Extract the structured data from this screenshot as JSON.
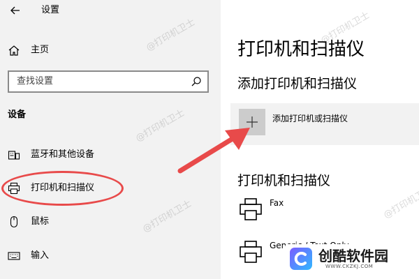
{
  "window": {
    "title": "设置"
  },
  "sidebar": {
    "home_label": "主页",
    "search": {
      "placeholder": "查找设置"
    },
    "section_heading": "设备",
    "items": [
      {
        "label": "蓝牙和其他设备",
        "icon": "keyboard-devices-icon"
      },
      {
        "label": "打印机和扫描仪",
        "icon": "printer-icon",
        "highlighted": true
      },
      {
        "label": "鼠标",
        "icon": "mouse-icon"
      },
      {
        "label": "输入",
        "icon": "keyboard-icon"
      }
    ]
  },
  "main": {
    "page_title": "打印机和扫描仪",
    "add_section_title": "添加打印机和扫描仪",
    "add_button_label": "添加打印机或扫描仪",
    "list_heading": "打印机和扫描仪",
    "printers": [
      {
        "name": "Fax",
        "icon": "printer-icon"
      },
      {
        "name": "Generic / Text Only",
        "icon": "printer-icon"
      }
    ]
  },
  "watermark": {
    "text": "@打印机卫士"
  },
  "brand": {
    "name": "创酷软件园",
    "url": "WWW.CKZKJ.COM"
  },
  "colors": {
    "sidebar_bg": "#f2f2f2",
    "annotation_red": "#e84a4a",
    "plus_tile": "#cccccc"
  }
}
